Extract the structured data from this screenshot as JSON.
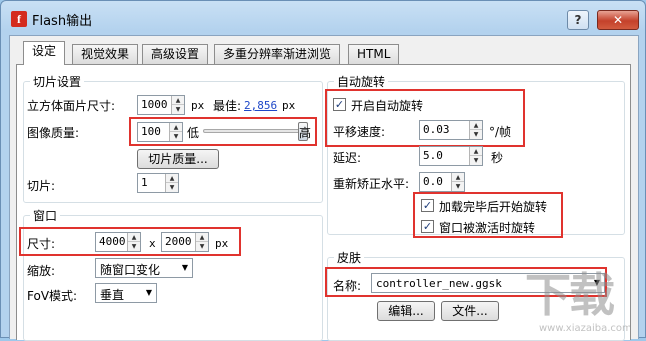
{
  "window": {
    "title": "Flash输出",
    "help_label": "?",
    "close_label": "✕",
    "app_icon_letter": "f"
  },
  "tabs": [
    {
      "label": "设定"
    },
    {
      "label": "视觉效果"
    },
    {
      "label": "高级设置"
    },
    {
      "label": "多重分辨率渐进浏览"
    },
    {
      "label": "HTML"
    }
  ],
  "slice_settings": {
    "title": "切片设置",
    "cube_size_label": "立方体面片尺寸:",
    "cube_size_value": "1000",
    "cube_size_unit": "px",
    "best_label": "最佳:",
    "best_value": "2,856",
    "best_unit": "px",
    "quality_label": "图像质量:",
    "quality_value": "100",
    "low_label": "低",
    "high_label": "高",
    "quality_slider_fraction": 1.0,
    "slice_quality_button": "切片质量...",
    "slice_label": "切片:",
    "slice_value": "1"
  },
  "window_group": {
    "title": "窗口",
    "size_label": "尺寸:",
    "width_value": "4000",
    "x_label": "x",
    "height_value": "2000",
    "size_unit": "px",
    "scale_label": "缩放:",
    "scale_value": "随窗口变化",
    "fov_label": "FoV模式:",
    "fov_value": "垂直"
  },
  "auto_rotate": {
    "title": "自动旋转",
    "enable_label": "开启自动旋转",
    "enable_checked": true,
    "pan_speed_label": "平移速度:",
    "pan_speed_value": "0.03",
    "pan_speed_unit": "°/帧",
    "delay_label": "延迟:",
    "delay_value": "5.0",
    "delay_unit": "秒",
    "relevel_label": "重新矫正水平:",
    "relevel_value": "0.0",
    "start_after_load_label": "加载完毕后开始旋转",
    "start_after_load_checked": true,
    "rotate_on_activate_label": "窗口被激活时旋转",
    "rotate_on_activate_checked": true
  },
  "skin": {
    "title": "皮肤",
    "name_label": "名称:",
    "name_value": "controller_new.ggsk",
    "edit_button": "编辑...",
    "file_button": "文件..."
  },
  "watermark": {
    "glyph": "下载",
    "sub": "www.xiazaiba.com"
  },
  "colors": {
    "highlight": "#e0332e",
    "title_bar": "#b3d2ee",
    "link": "#1f48c8"
  }
}
